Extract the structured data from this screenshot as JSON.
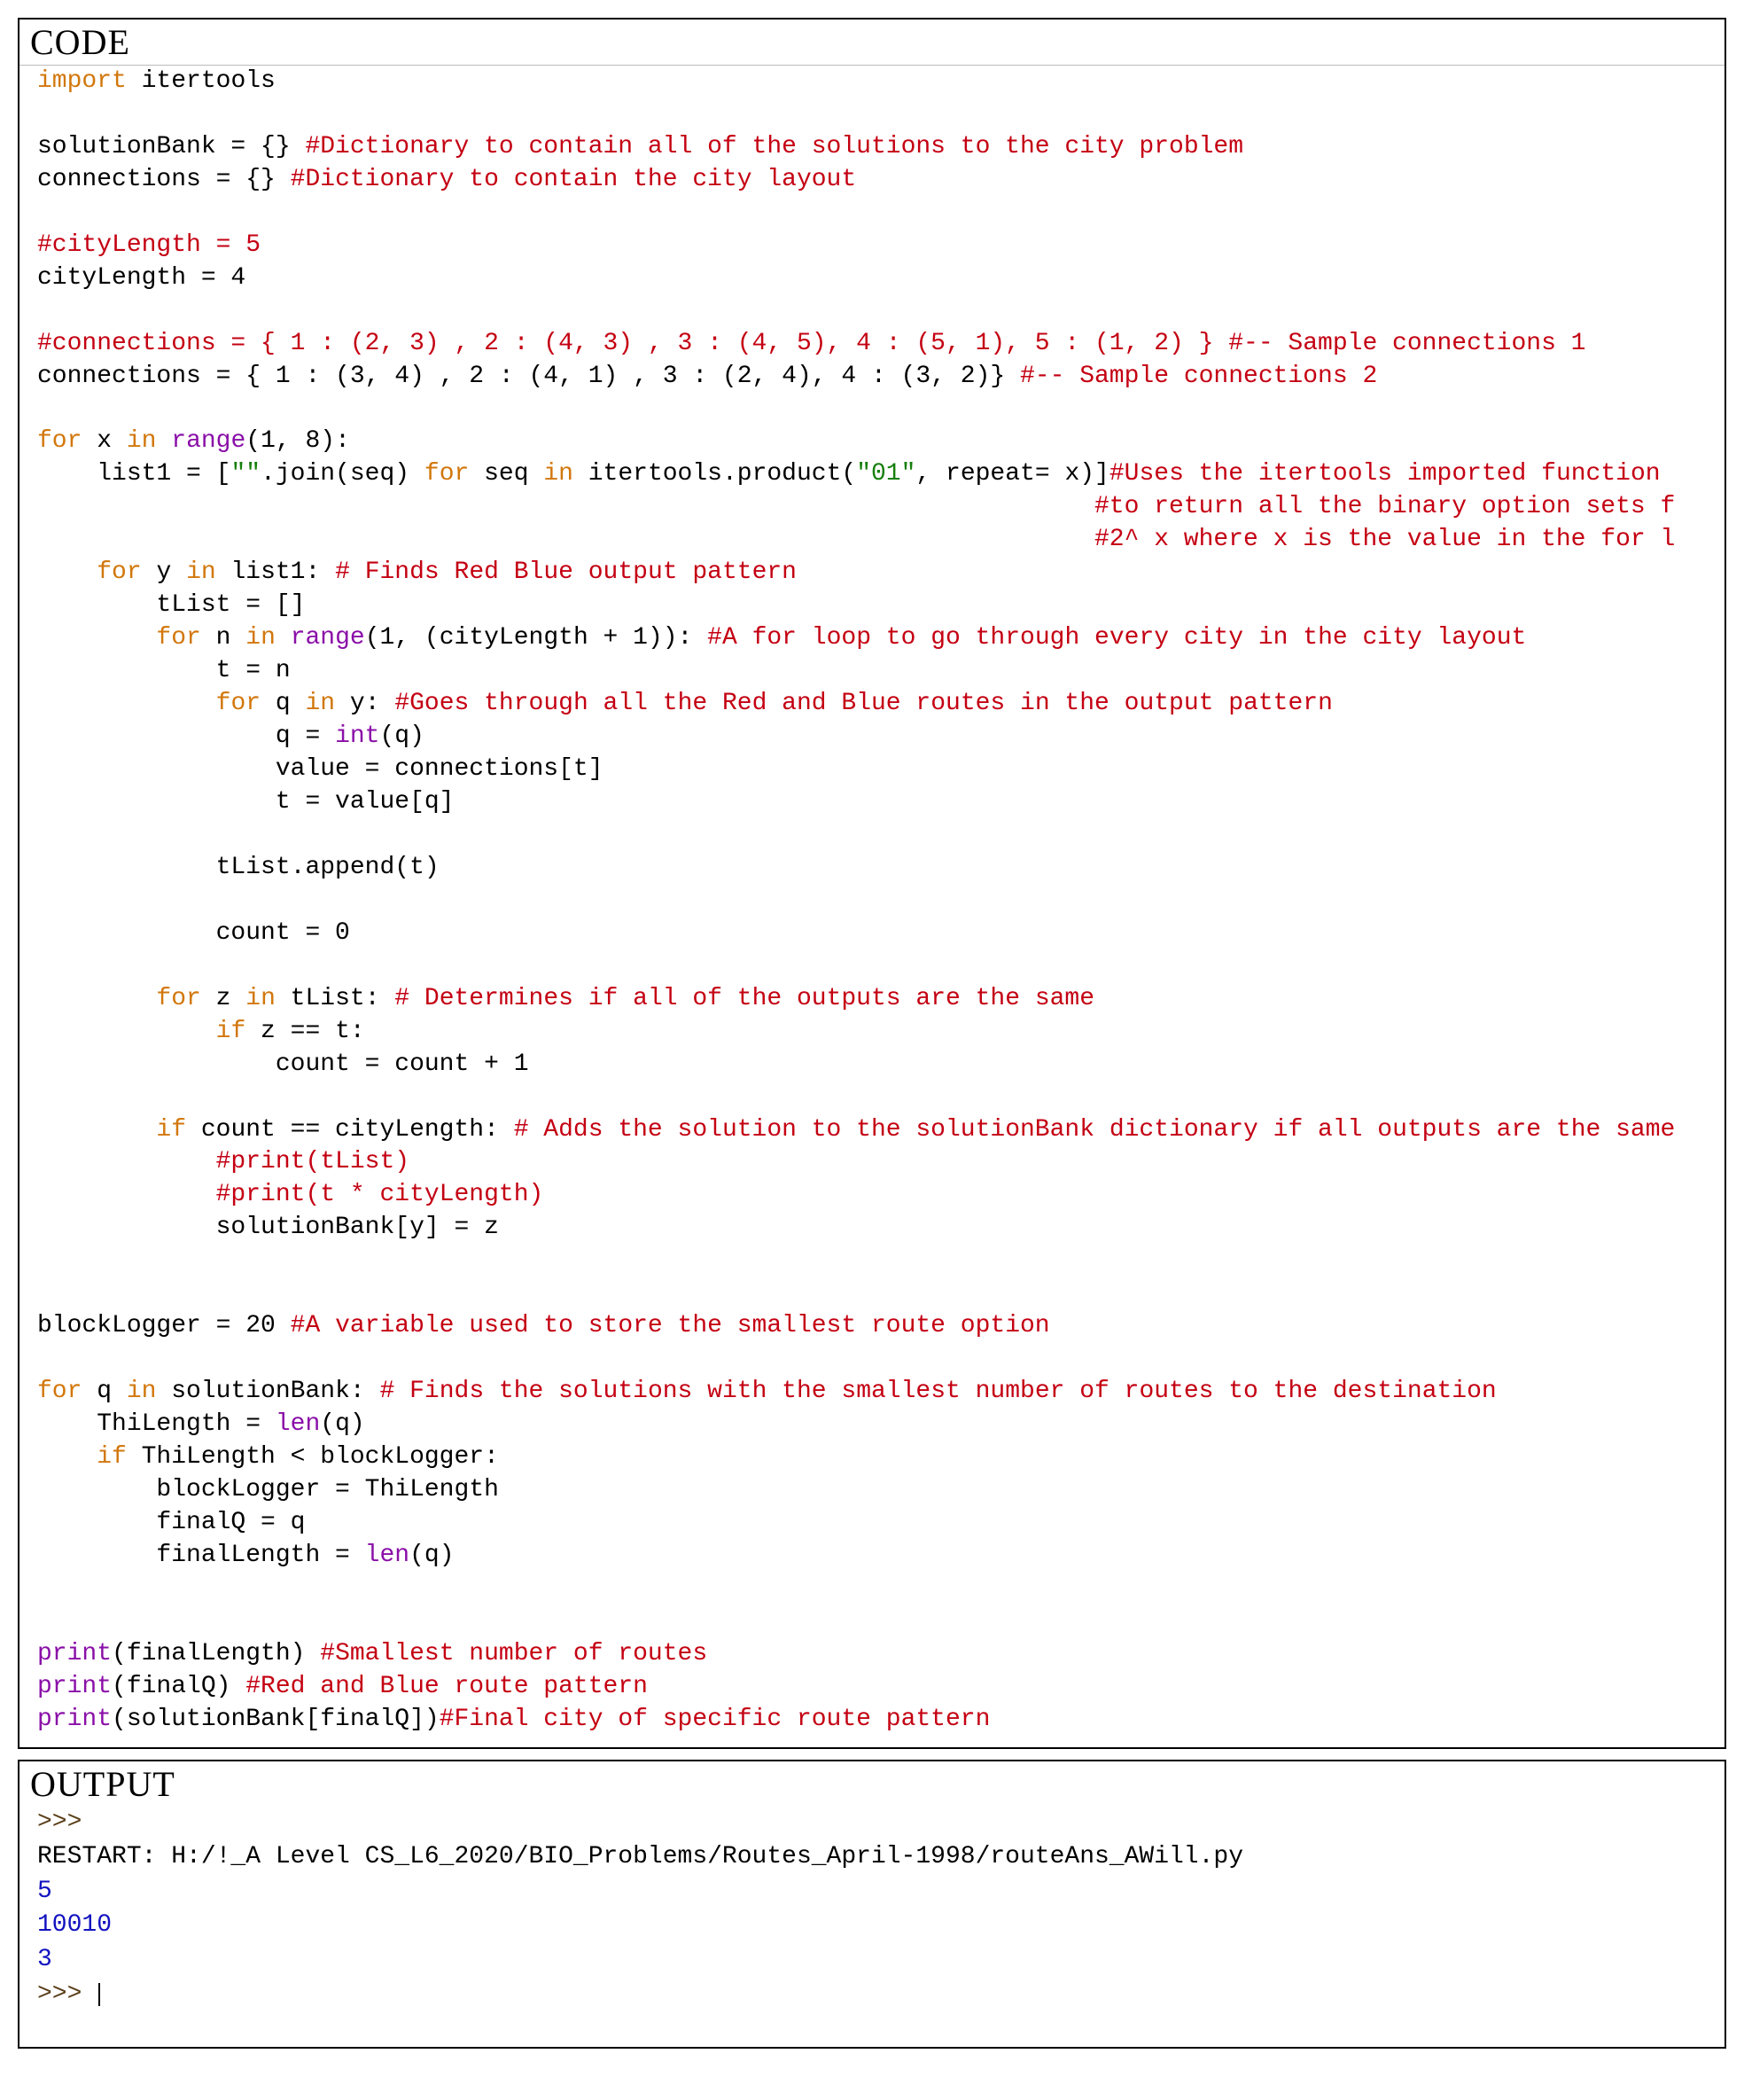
{
  "panels": {
    "code_title": "CODE",
    "output_title": "OUTPUT"
  },
  "code_tokens": {
    "l1_import": "import",
    "l1_rest": " itertools",
    "l3_a": "solutionBank = {} ",
    "l3_c": "#Dictionary to contain all of the solutions to the city problem",
    "l4_a": "connections = {} ",
    "l4_c": "#Dictionary to contain the city layout",
    "l6_c": "#cityLength = 5",
    "l7_a": "cityLength = 4",
    "l9_c": "#connections = { 1 : (2, 3) , 2 : (4, 3) , 3 : (4, 5), 4 : (5, 1), 5 : (1, 2) } #-- Sample connections 1",
    "l10_a": "connections = { 1 : (3, 4) , 2 : (4, 1) , 3 : (2, 4), 4 : (3, 2)} ",
    "l10_c": "#-- Sample connections 2",
    "l12_for": "for",
    "l12_a": " x ",
    "l12_in": "in",
    "l12_sp": " ",
    "l12_range": "range",
    "l12_b": "(1, 8):",
    "l13_a": "    list1 = [",
    "l13_s1": "\"\"",
    "l13_b": ".join(seq) ",
    "l13_for": "for",
    "l13_c": " seq ",
    "l13_in": "in",
    "l13_d": " itertools.product(",
    "l13_s2": "\"01\"",
    "l13_e": ", repeat= x)]",
    "l13_cm": "#Uses the itertools imported function",
    "l14_cm": "                                                                       #to return all the binary option sets f",
    "l15_cm": "                                                                       #2^ x where x is the value in the for l",
    "l16_for": "for",
    "l16_a": " y ",
    "l16_in": "in",
    "l16_b": " list1: ",
    "l16_cm": "# Finds Red Blue output pattern",
    "l17_a": "        tList = []",
    "l18_for": "for",
    "l18_a": " n ",
    "l18_in": "in",
    "l18_sp": " ",
    "l18_range": "range",
    "l18_b": "(1, (cityLength + 1)): ",
    "l18_cm": "#A for loop to go through every city in the city layout",
    "l19_a": "            t = n",
    "l20_for": "for",
    "l20_a": " q ",
    "l20_in": "in",
    "l20_b": " y: ",
    "l20_cm": "#Goes through all the Red and Blue routes in the output pattern",
    "l21_a": "                q = ",
    "l21_int": "int",
    "l21_b": "(q)",
    "l22_a": "                value = connections[t]",
    "l23_a": "                t = value[q]",
    "l25_a": "            tList.append(t)",
    "l27_a": "            count = 0",
    "l29_for": "for",
    "l29_a": " z ",
    "l29_in": "in",
    "l29_b": " tList: ",
    "l29_cm": "# Determines if all of the outputs are the same",
    "l30_if": "if",
    "l30_a": " z == t:",
    "l31_a": "                count = count + 1",
    "l33_if": "if",
    "l33_a": " count == cityLength: ",
    "l33_cm": "# Adds the solution to the solutionBank dictionary if all outputs are the same",
    "l34_cm": "            #print(tList)",
    "l35_cm": "            #print(t * cityLength)",
    "l36_a": "            solutionBank[y] = z",
    "l39_a": "blockLogger = 20 ",
    "l39_cm": "#A variable used to store the smallest route option",
    "l41_for": "for",
    "l41_a": " q ",
    "l41_in": "in",
    "l41_b": " solutionBank: ",
    "l41_cm": "# Finds the solutions with the smallest number of routes to the destination",
    "l42_a": "    ThiLength = ",
    "l42_len": "len",
    "l42_b": "(q)",
    "l43_if": "if",
    "l43_a": " ThiLength < blockLogger:",
    "l44_a": "        blockLogger = ThiLength",
    "l45_a": "        finalQ = q",
    "l46_a": "        finalLength = ",
    "l46_len": "len",
    "l46_b": "(q)",
    "l49_print": "print",
    "l49_a": "(finalLength) ",
    "l49_cm": "#Smallest number of routes",
    "l50_print": "print",
    "l50_a": "(finalQ) ",
    "l50_cm": "#Red and Blue route pattern",
    "l51_print": "print",
    "l51_a": "(solutionBank[finalQ])",
    "l51_cm": "#Final city of specific route pattern"
  },
  "output": {
    "prompt1": ">>>",
    "restart": " RESTART: H:/!_A Level CS_L6_2020/BIO_Problems/Routes_April-1998/routeAns_AWill.py ",
    "val1": "5",
    "val2": "10010",
    "val3": "3",
    "prompt2": ">>> "
  }
}
